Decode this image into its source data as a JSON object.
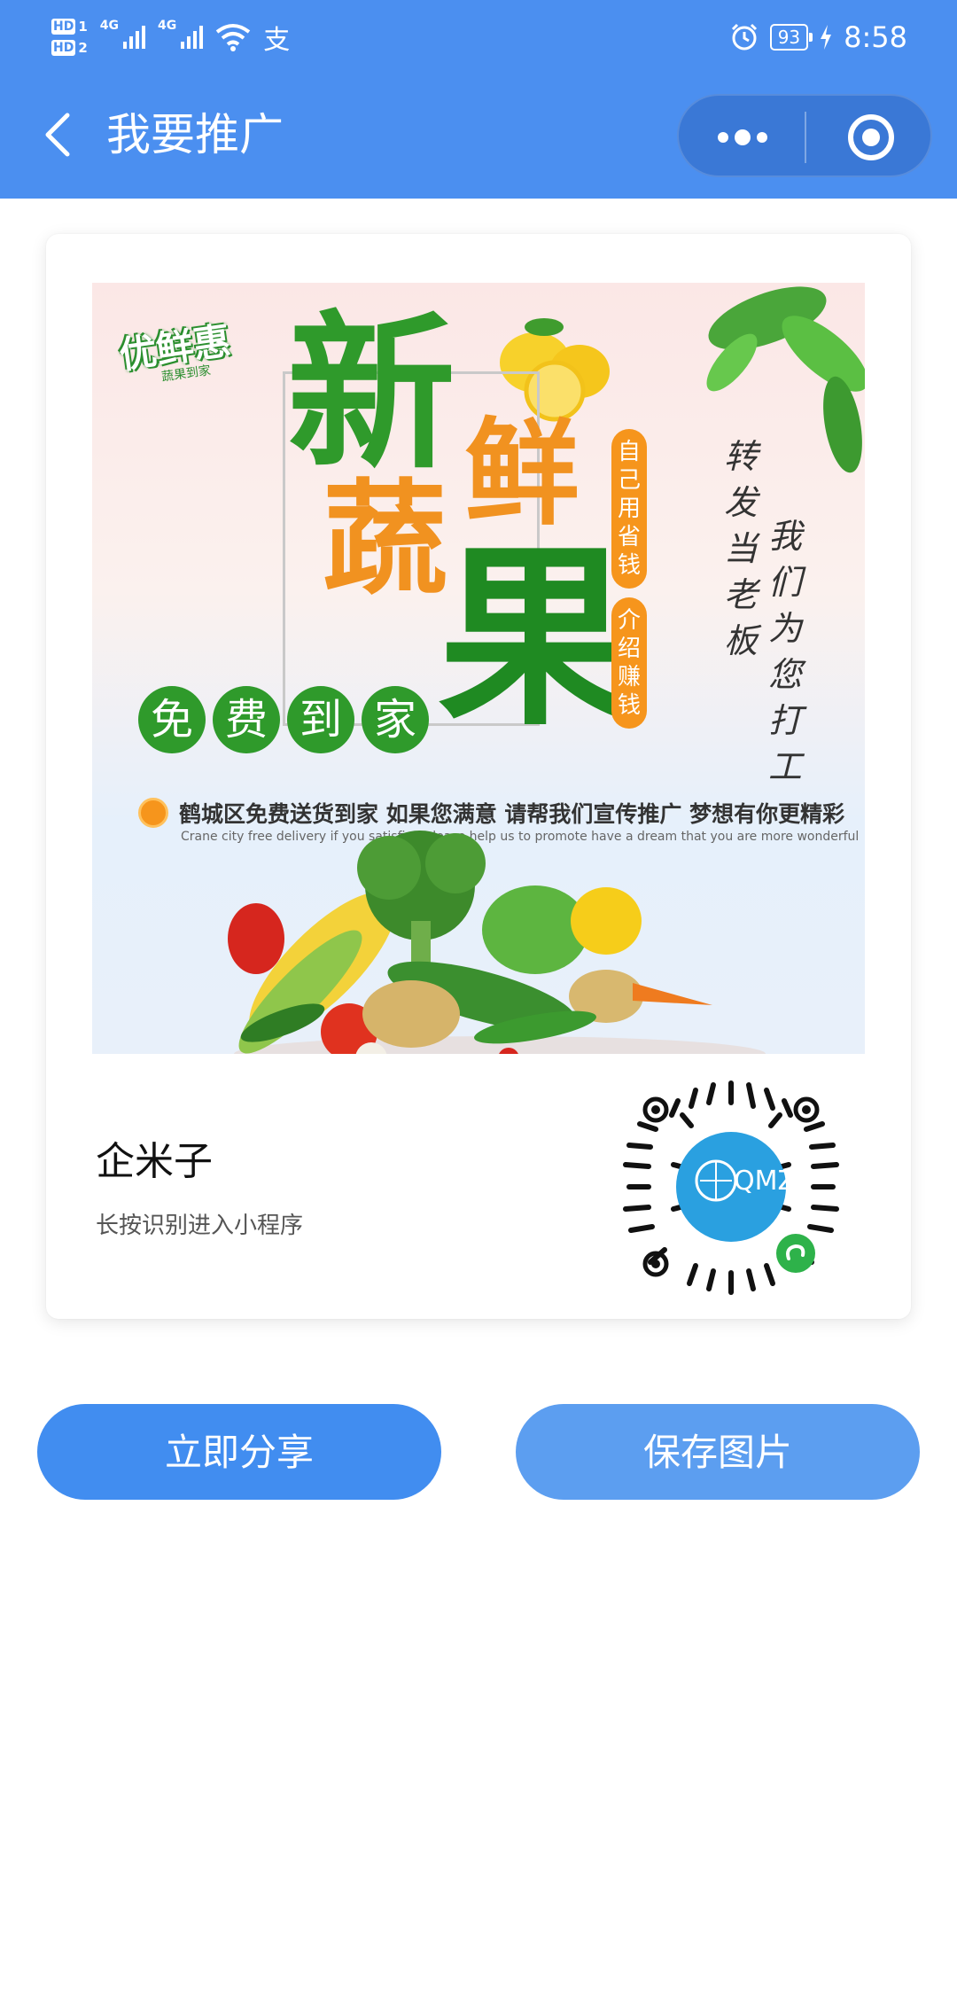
{
  "status_bar": {
    "hd1": "HD",
    "hd1_sub": "1",
    "hd2": "HD",
    "hd2_sub": "2",
    "net1": "4G",
    "net2": "4G",
    "alipay": "支",
    "battery": "93",
    "time": "8:58"
  },
  "nav": {
    "title": "我要推广",
    "back_icon": "chevron-left-icon",
    "more_icon": "more-dots-icon",
    "close_icon": "target-close-icon"
  },
  "poster": {
    "brand": "优鲜惠",
    "brand_sub": "蔬果到家",
    "headline": [
      "新",
      "鲜",
      "蔬",
      "果"
    ],
    "pill_1": "自己用省钱",
    "pill_2": "介绍赚钱",
    "vertical_1": "转发当老板",
    "vertical_2": "我们为您打工",
    "free_delivery": [
      "免",
      "费",
      "到",
      "家"
    ],
    "slogan_cn": "鹤城区免费送货到家  如果您满意  请帮我们宣传推广  梦想有你更精彩",
    "slogan_en": "Crane city free delivery if you satisfied please help us to promote have a dream that you are more wonderful"
  },
  "mini_program": {
    "name": "企米子",
    "hint": "长按识别进入小程序",
    "qr_label": "QMZ"
  },
  "buttons": {
    "share": "立即分享",
    "save": "保存图片"
  },
  "colors": {
    "nav_bg": "#4b8ff0",
    "share_btn": "#418df0",
    "save_btn": "#5c9ef0"
  }
}
